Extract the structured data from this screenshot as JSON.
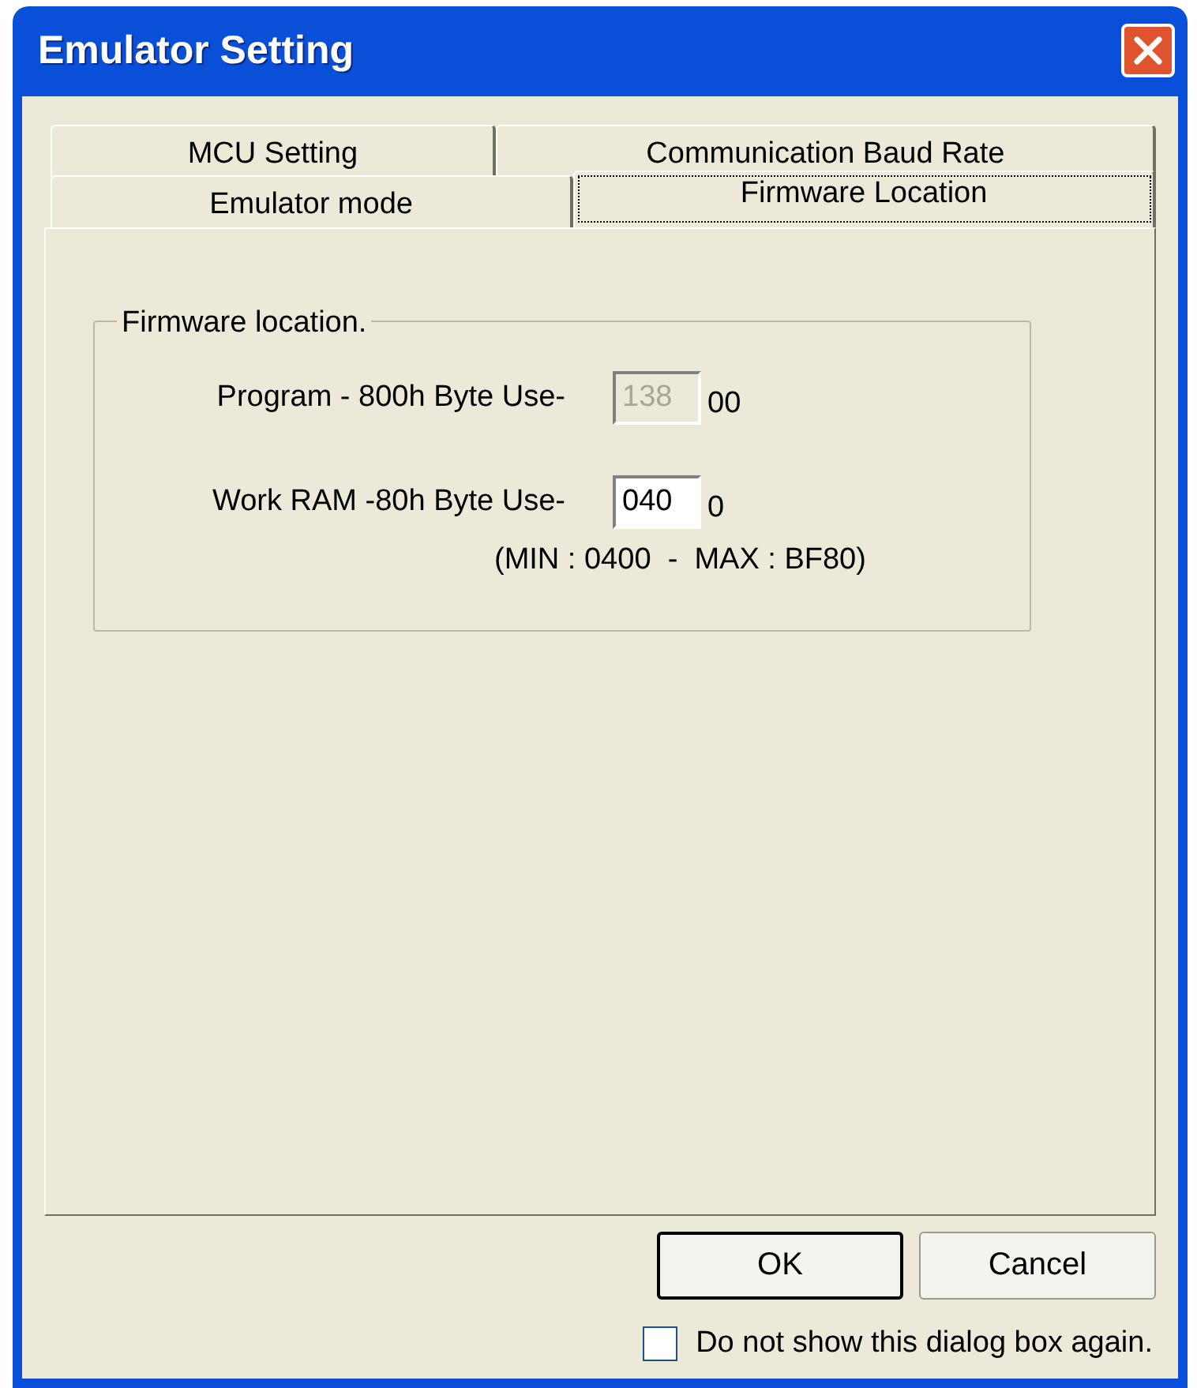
{
  "window": {
    "title": "Emulator Setting"
  },
  "tab_rows": [
    [
      {
        "label": "MCU Setting",
        "selected": false
      },
      {
        "label": "Communication Baud Rate",
        "selected": false
      }
    ],
    [
      {
        "label": "Emulator mode",
        "selected": false
      },
      {
        "label": "Firmware Location",
        "selected": true
      }
    ]
  ],
  "group": {
    "legend": "Firmware location.",
    "fields": [
      {
        "label": "Program - 800h Byte Use-",
        "value": "138",
        "suffix": "00",
        "disabled": true
      },
      {
        "label": "Work RAM -80h Byte Use-",
        "value": "040",
        "suffix": "0",
        "disabled": false
      }
    ],
    "range_note": "(MIN : 0400  -  MAX : BF80)"
  },
  "buttons": [
    {
      "label": "OK",
      "default": true
    },
    {
      "label": "Cancel",
      "default": false
    }
  ],
  "checkbox": {
    "label": "Do not show this dialog box again.",
    "checked": false
  }
}
